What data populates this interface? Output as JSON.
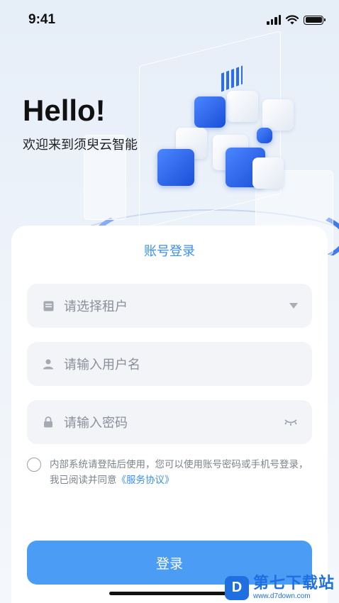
{
  "status_bar": {
    "time": "9:41"
  },
  "hero": {
    "greeting": "Hello!",
    "welcome": "欢迎来到须臾云智能"
  },
  "login_card": {
    "title": "账号登录",
    "tenant": {
      "placeholder": "请选择租户",
      "icon": "document-icon"
    },
    "username": {
      "placeholder": "请输入用户名",
      "icon": "user-icon"
    },
    "password": {
      "placeholder": "请输入密码",
      "icon": "lock-icon",
      "toggle_icon": "eye-closed-icon"
    },
    "agreement": {
      "text": "内部系统请登陆后使用，您可以使用账号密码或手机号登录，我已阅读并同意",
      "link": "《服务协议》"
    },
    "login_button": "登录"
  },
  "watermark": {
    "logo_letter": "D",
    "name": "第七下载站",
    "url": "www.d7down.com"
  },
  "colors": {
    "accent": "#3b8ff0",
    "button": "#4a9cf5",
    "field_bg": "#f2f4f8",
    "cube_blue": "#2f6de8"
  }
}
